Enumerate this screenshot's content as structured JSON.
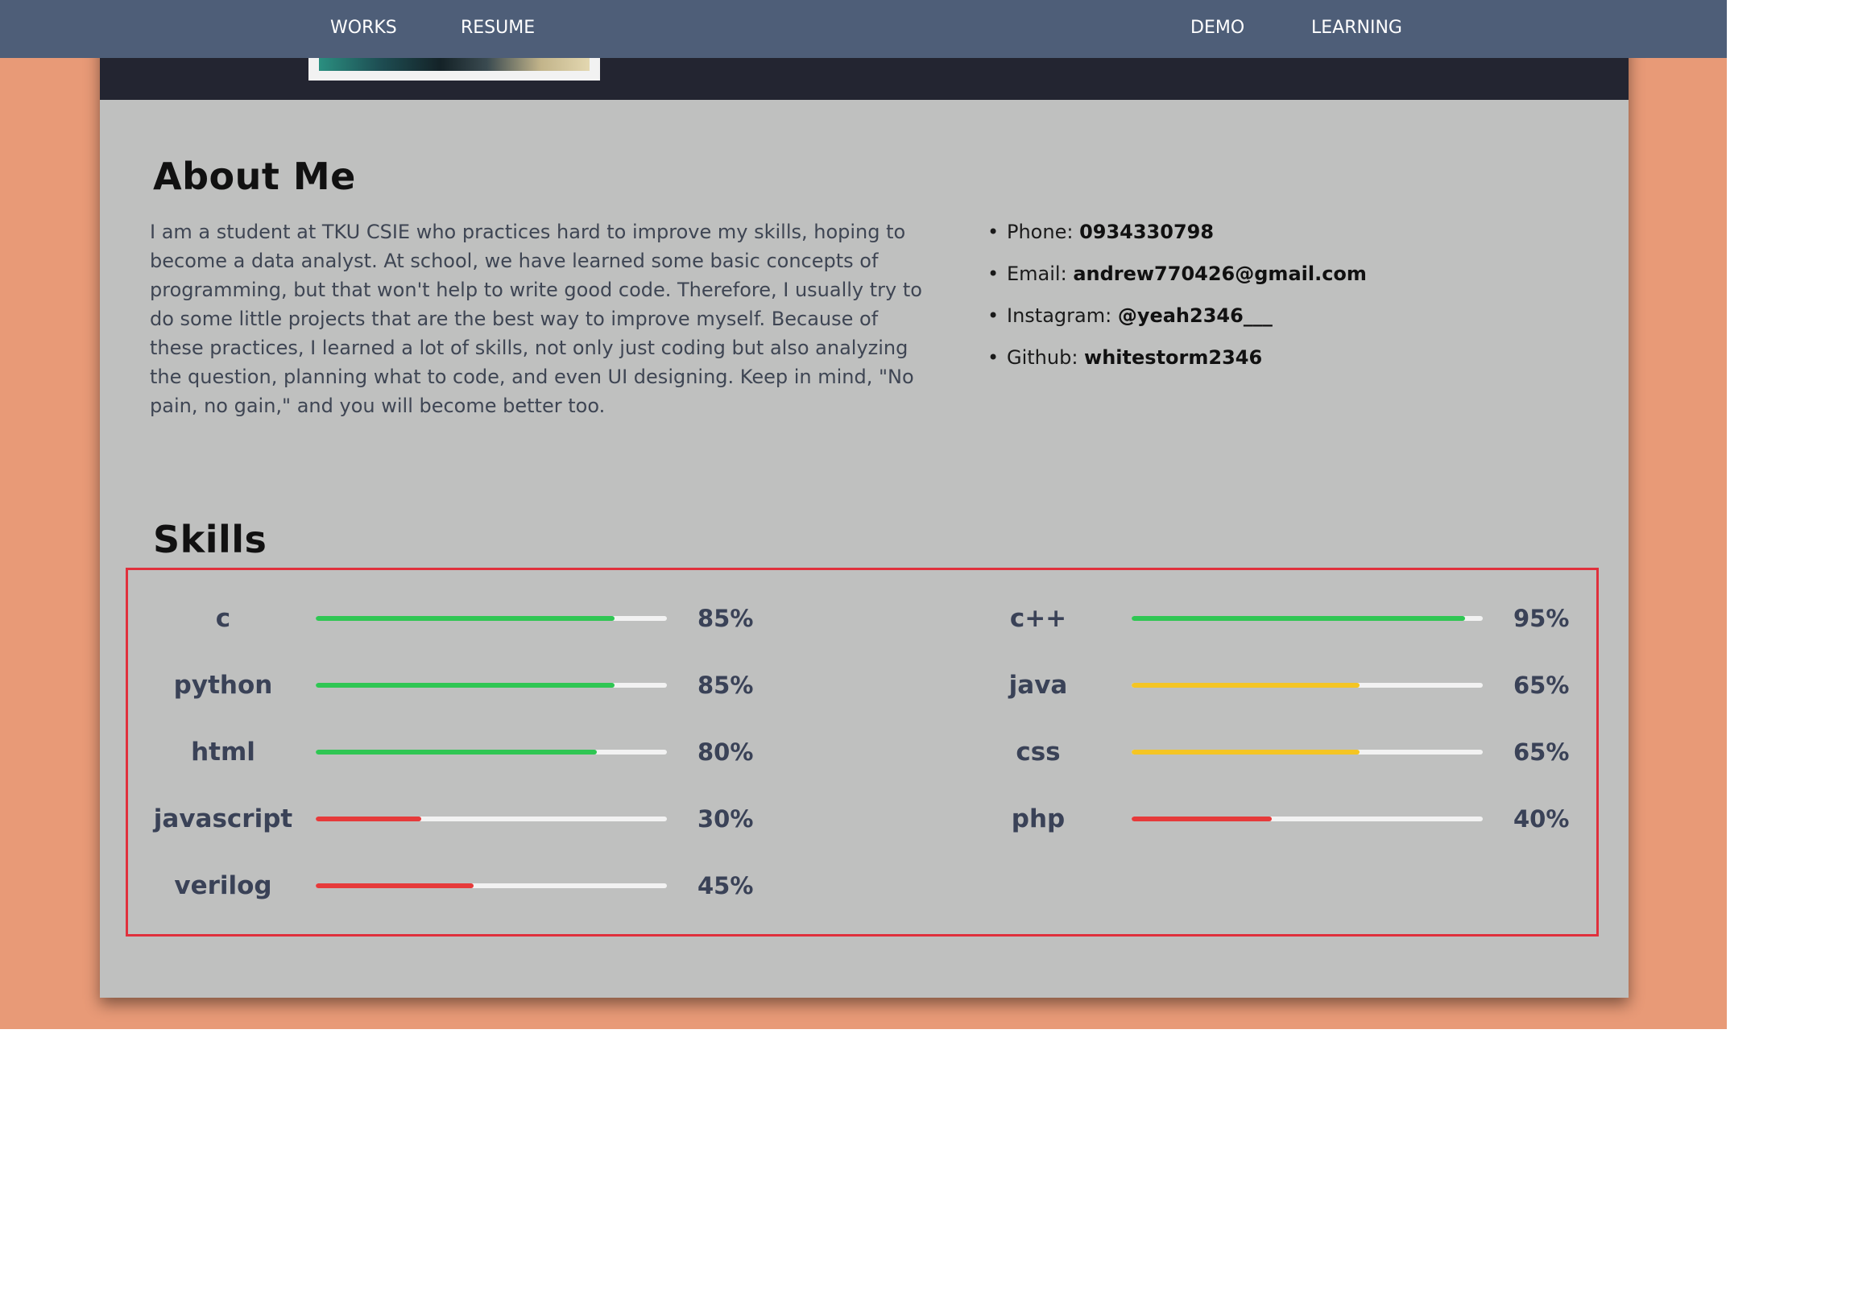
{
  "nav": {
    "items": [
      {
        "label": "WORKS"
      },
      {
        "label": "RESUME"
      },
      {
        "label": "DEMO"
      },
      {
        "label": "LEARNING"
      }
    ]
  },
  "about": {
    "title": "About Me",
    "text": "I am a student at TKU CSIE who practices hard to improve my skills, hoping to become a data analyst. At school, we have learned some basic concepts of programming, but that won't help to write good code. Therefore, I usually try to do some little projects that are the best way to improve myself. Because of these practices, I learned a lot of skills, not only just coding but also analyzing the question, planning what to code, and even UI designing. Keep in mind, \"No pain, no gain,\" and you will become better too."
  },
  "contact": [
    {
      "label": "Phone: ",
      "value": "0934330798"
    },
    {
      "label": "Email: ",
      "value": "andrew770426@gmail.com"
    },
    {
      "label": "Instagram: ",
      "value": "@yeah2346___"
    },
    {
      "label": "Github: ",
      "value": "whitestorm2346"
    }
  ],
  "skills": {
    "title": "Skills",
    "colors": {
      "high": "#2fc653",
      "mid": "#f4c524",
      "low": "#e63a3a",
      "track": "#f2f2f2"
    },
    "left": [
      {
        "name": "c",
        "level": 0.85,
        "percent": "85%",
        "tier": "high"
      },
      {
        "name": "python",
        "level": 0.85,
        "percent": "85%",
        "tier": "high"
      },
      {
        "name": "html",
        "level": 0.8,
        "percent": "80%",
        "tier": "high"
      },
      {
        "name": "javascript",
        "level": 0.3,
        "percent": "30%",
        "tier": "low"
      },
      {
        "name": "verilog",
        "level": 0.45,
        "percent": "45%",
        "tier": "low"
      }
    ],
    "right": [
      {
        "name": "c++",
        "level": 0.95,
        "percent": "95%",
        "tier": "high"
      },
      {
        "name": "java",
        "level": 0.65,
        "percent": "65%",
        "tier": "mid"
      },
      {
        "name": "css",
        "level": 0.65,
        "percent": "65%",
        "tier": "mid"
      },
      {
        "name": "php",
        "level": 0.4,
        "percent": "40%",
        "tier": "low"
      }
    ]
  }
}
